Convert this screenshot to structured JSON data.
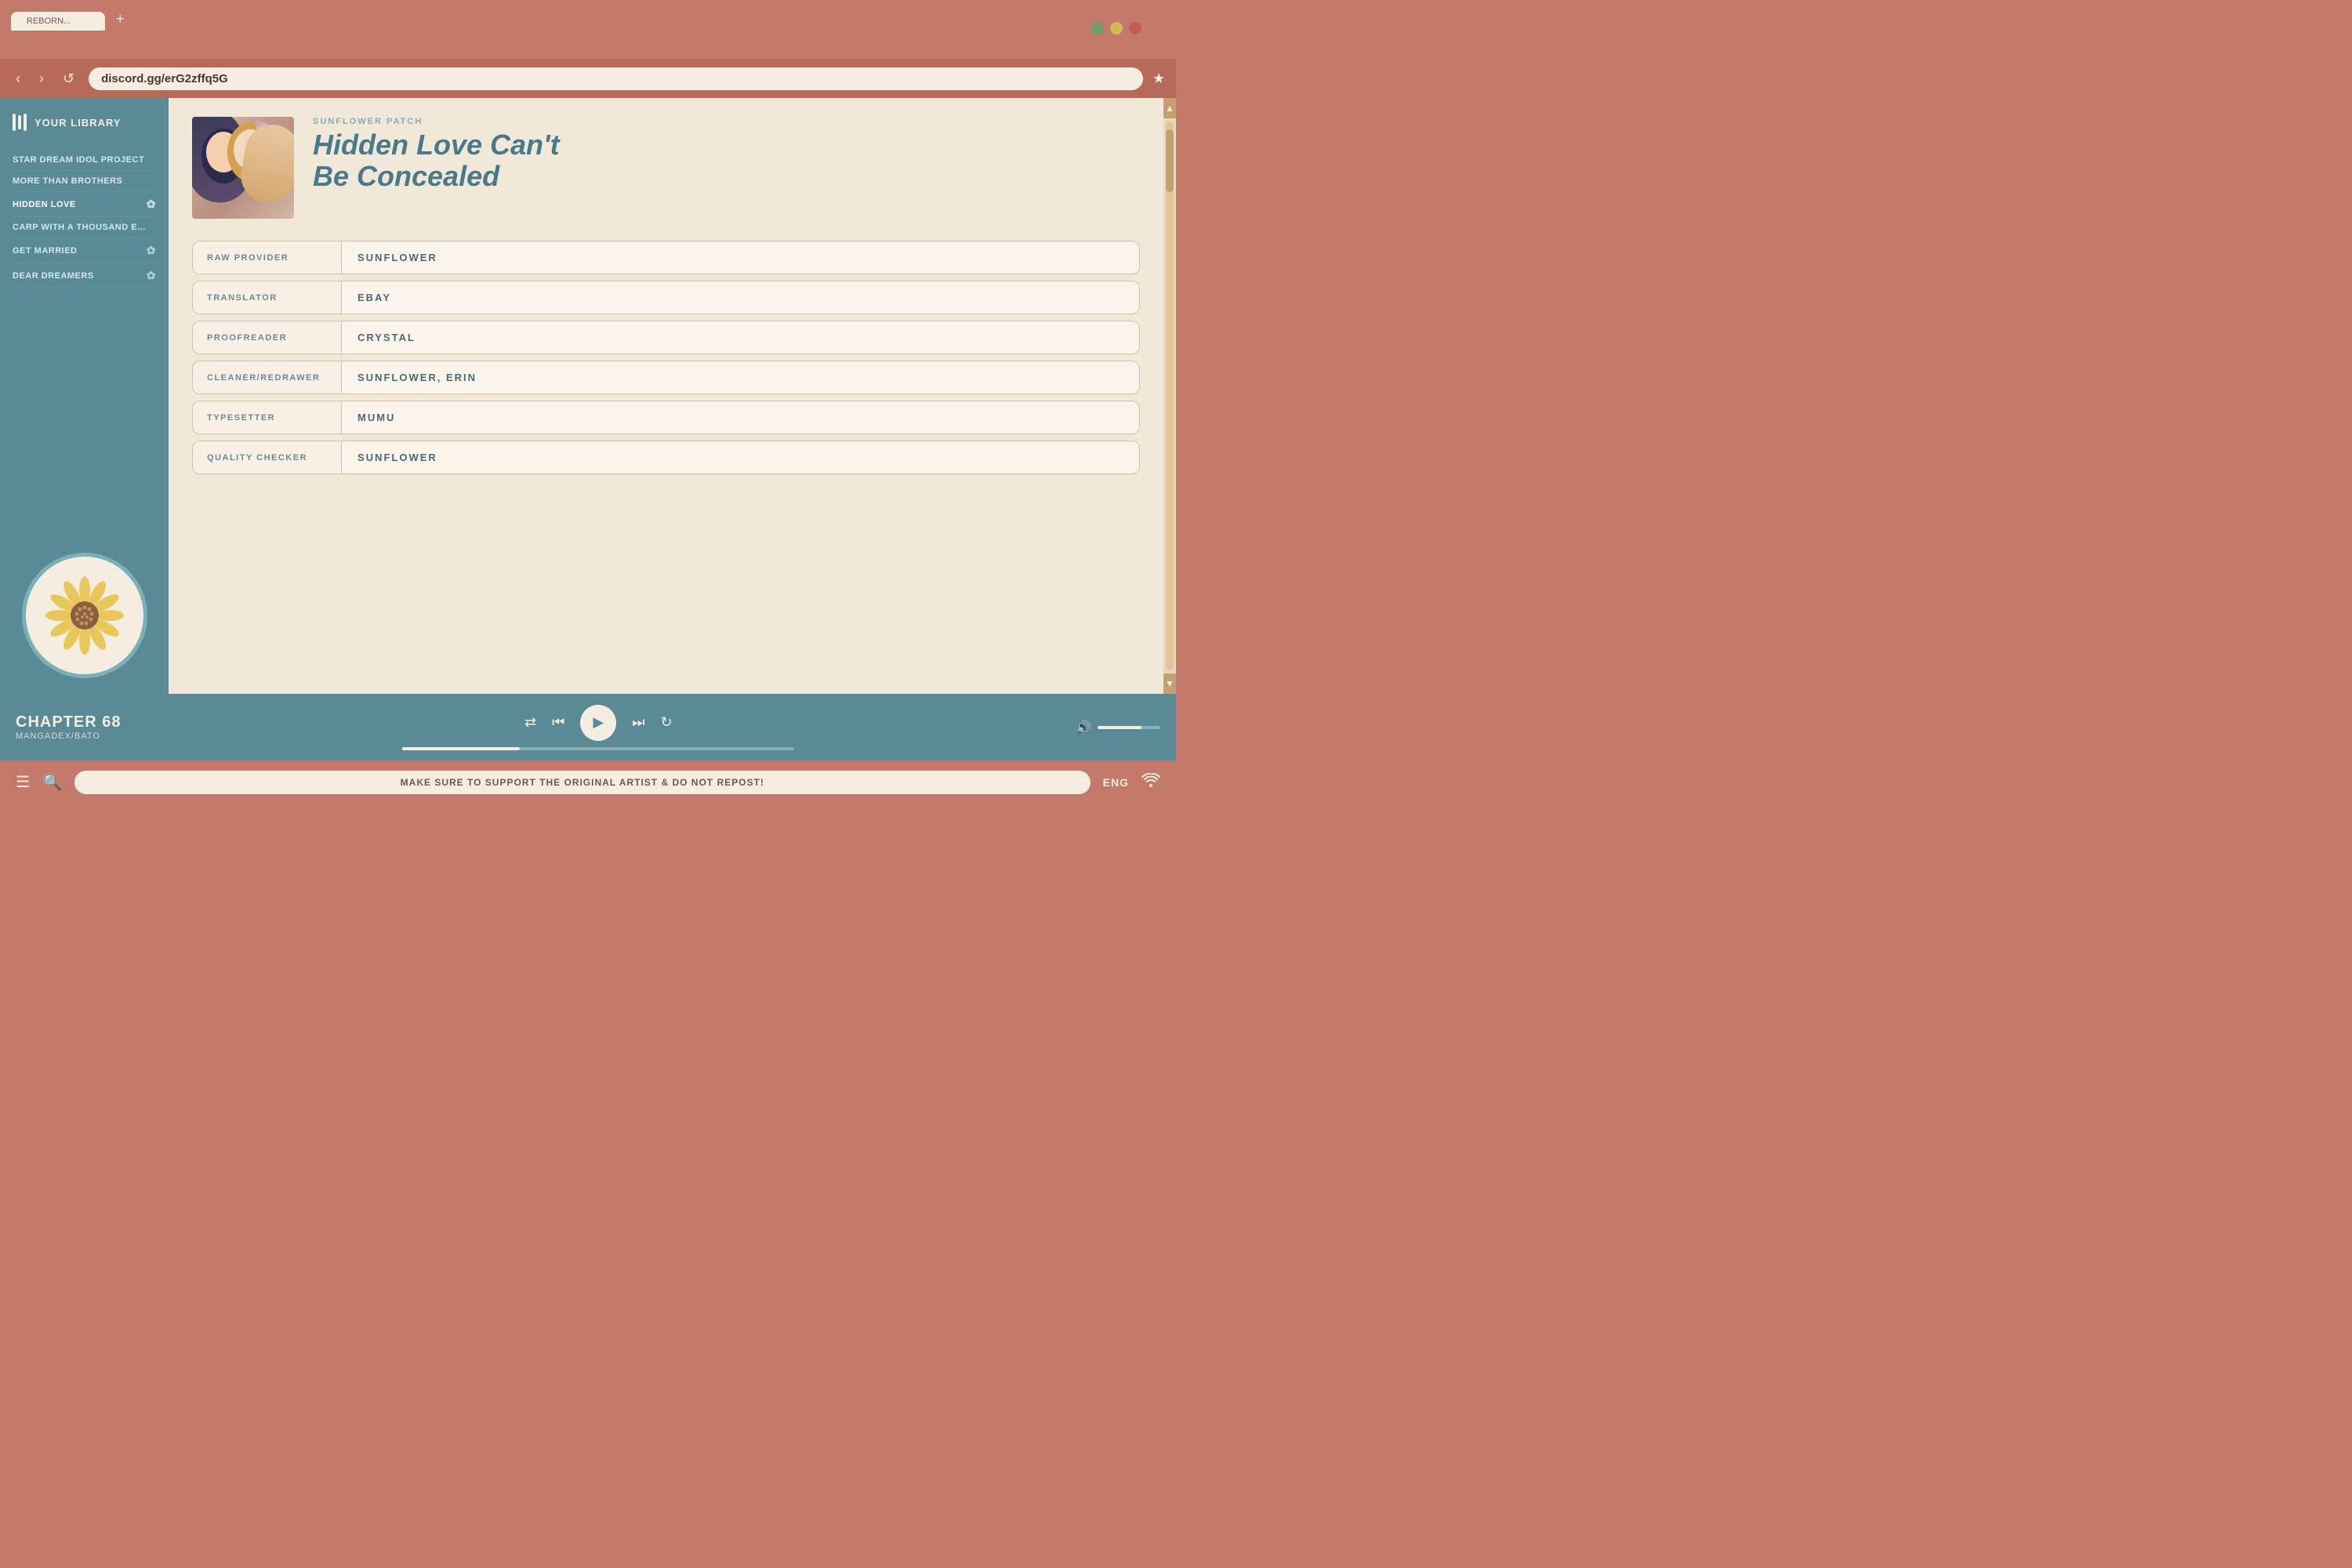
{
  "browser": {
    "tab_active": "REBORN...",
    "tab_new_label": "+",
    "address": "discord.gg/erG2zffq5G",
    "back_btn": "‹",
    "forward_btn": "›",
    "refresh_btn": "↺",
    "bookmark_btn": "★",
    "traffic_lights": [
      "green",
      "yellow",
      "red"
    ]
  },
  "sidebar": {
    "library_label": "YOUR LIBRARY",
    "items": [
      {
        "label": "STAR DREAM IDOL PROJECT",
        "has_icon": false
      },
      {
        "label": "MORE THAN BROTHERS",
        "has_icon": false
      },
      {
        "label": "HIDDEN LOVE",
        "has_icon": true
      },
      {
        "label": "CARP WITH A THOUSAND E...",
        "has_icon": false
      },
      {
        "label": "GET MARRIED",
        "has_icon": true
      },
      {
        "label": "DEAR DREAMERS",
        "has_icon": true
      }
    ]
  },
  "manga": {
    "publisher": "SUNFLOWER PATCH",
    "title_line1": "Hidden Love Can't",
    "title_line2": "Be Concealed"
  },
  "credits": [
    {
      "label": "RAW PROVIDER",
      "value": "SUNFLOWER"
    },
    {
      "label": "TRANSLATOR",
      "value": "EBAY"
    },
    {
      "label": "PROOFREADER",
      "value": "CRYSTAL"
    },
    {
      "label": "CLEANER/REDRAWER",
      "value": "SUNFLOWER, ERIN"
    },
    {
      "label": "TYPESETTER",
      "value": "MUMU"
    },
    {
      "label": "QUALITY CHECKER",
      "value": "SUNFLOWER"
    }
  ],
  "player": {
    "chapter": "CHAPTER 68",
    "source": "MANGADEX/BATO",
    "progress_pct": 30,
    "volume_pct": 70
  },
  "bottom_bar": {
    "notice": "MAKE SURE TO SUPPORT THE ORIGINAL ARTIST & DO NOT REPOST!",
    "language": "ENG"
  }
}
